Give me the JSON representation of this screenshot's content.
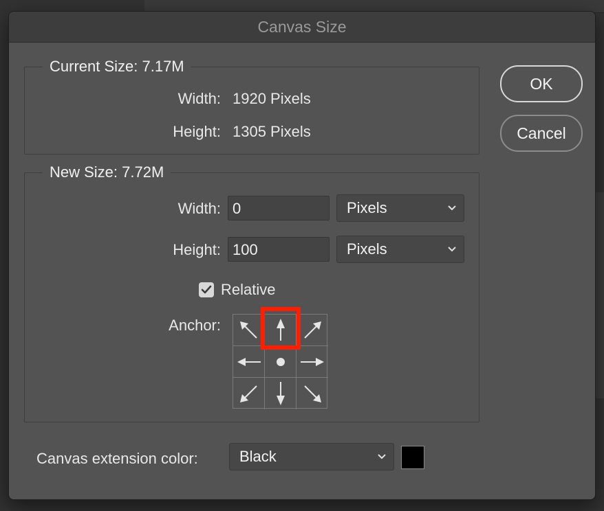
{
  "dialog": {
    "title": "Canvas Size"
  },
  "current_size": {
    "legend": "Current Size: 7.17M",
    "width_label": "Width:",
    "width_value": "1920 Pixels",
    "height_label": "Height:",
    "height_value": "1305 Pixels"
  },
  "new_size": {
    "legend": "New Size: 7.72M",
    "width_label": "Width:",
    "width_value": "0",
    "width_unit": "Pixels",
    "height_label": "Height:",
    "height_value": "100",
    "height_unit": "Pixels",
    "relative_label": "Relative",
    "relative_checked": true,
    "anchor_label": "Anchor:",
    "anchor_selected": "top-center"
  },
  "extension": {
    "label": "Canvas extension color:",
    "value": "Black",
    "swatch_color": "#000000"
  },
  "buttons": {
    "ok": "OK",
    "cancel": "Cancel"
  },
  "colors": {
    "highlight": "#ff1e00",
    "dialog_bg": "#535353"
  }
}
